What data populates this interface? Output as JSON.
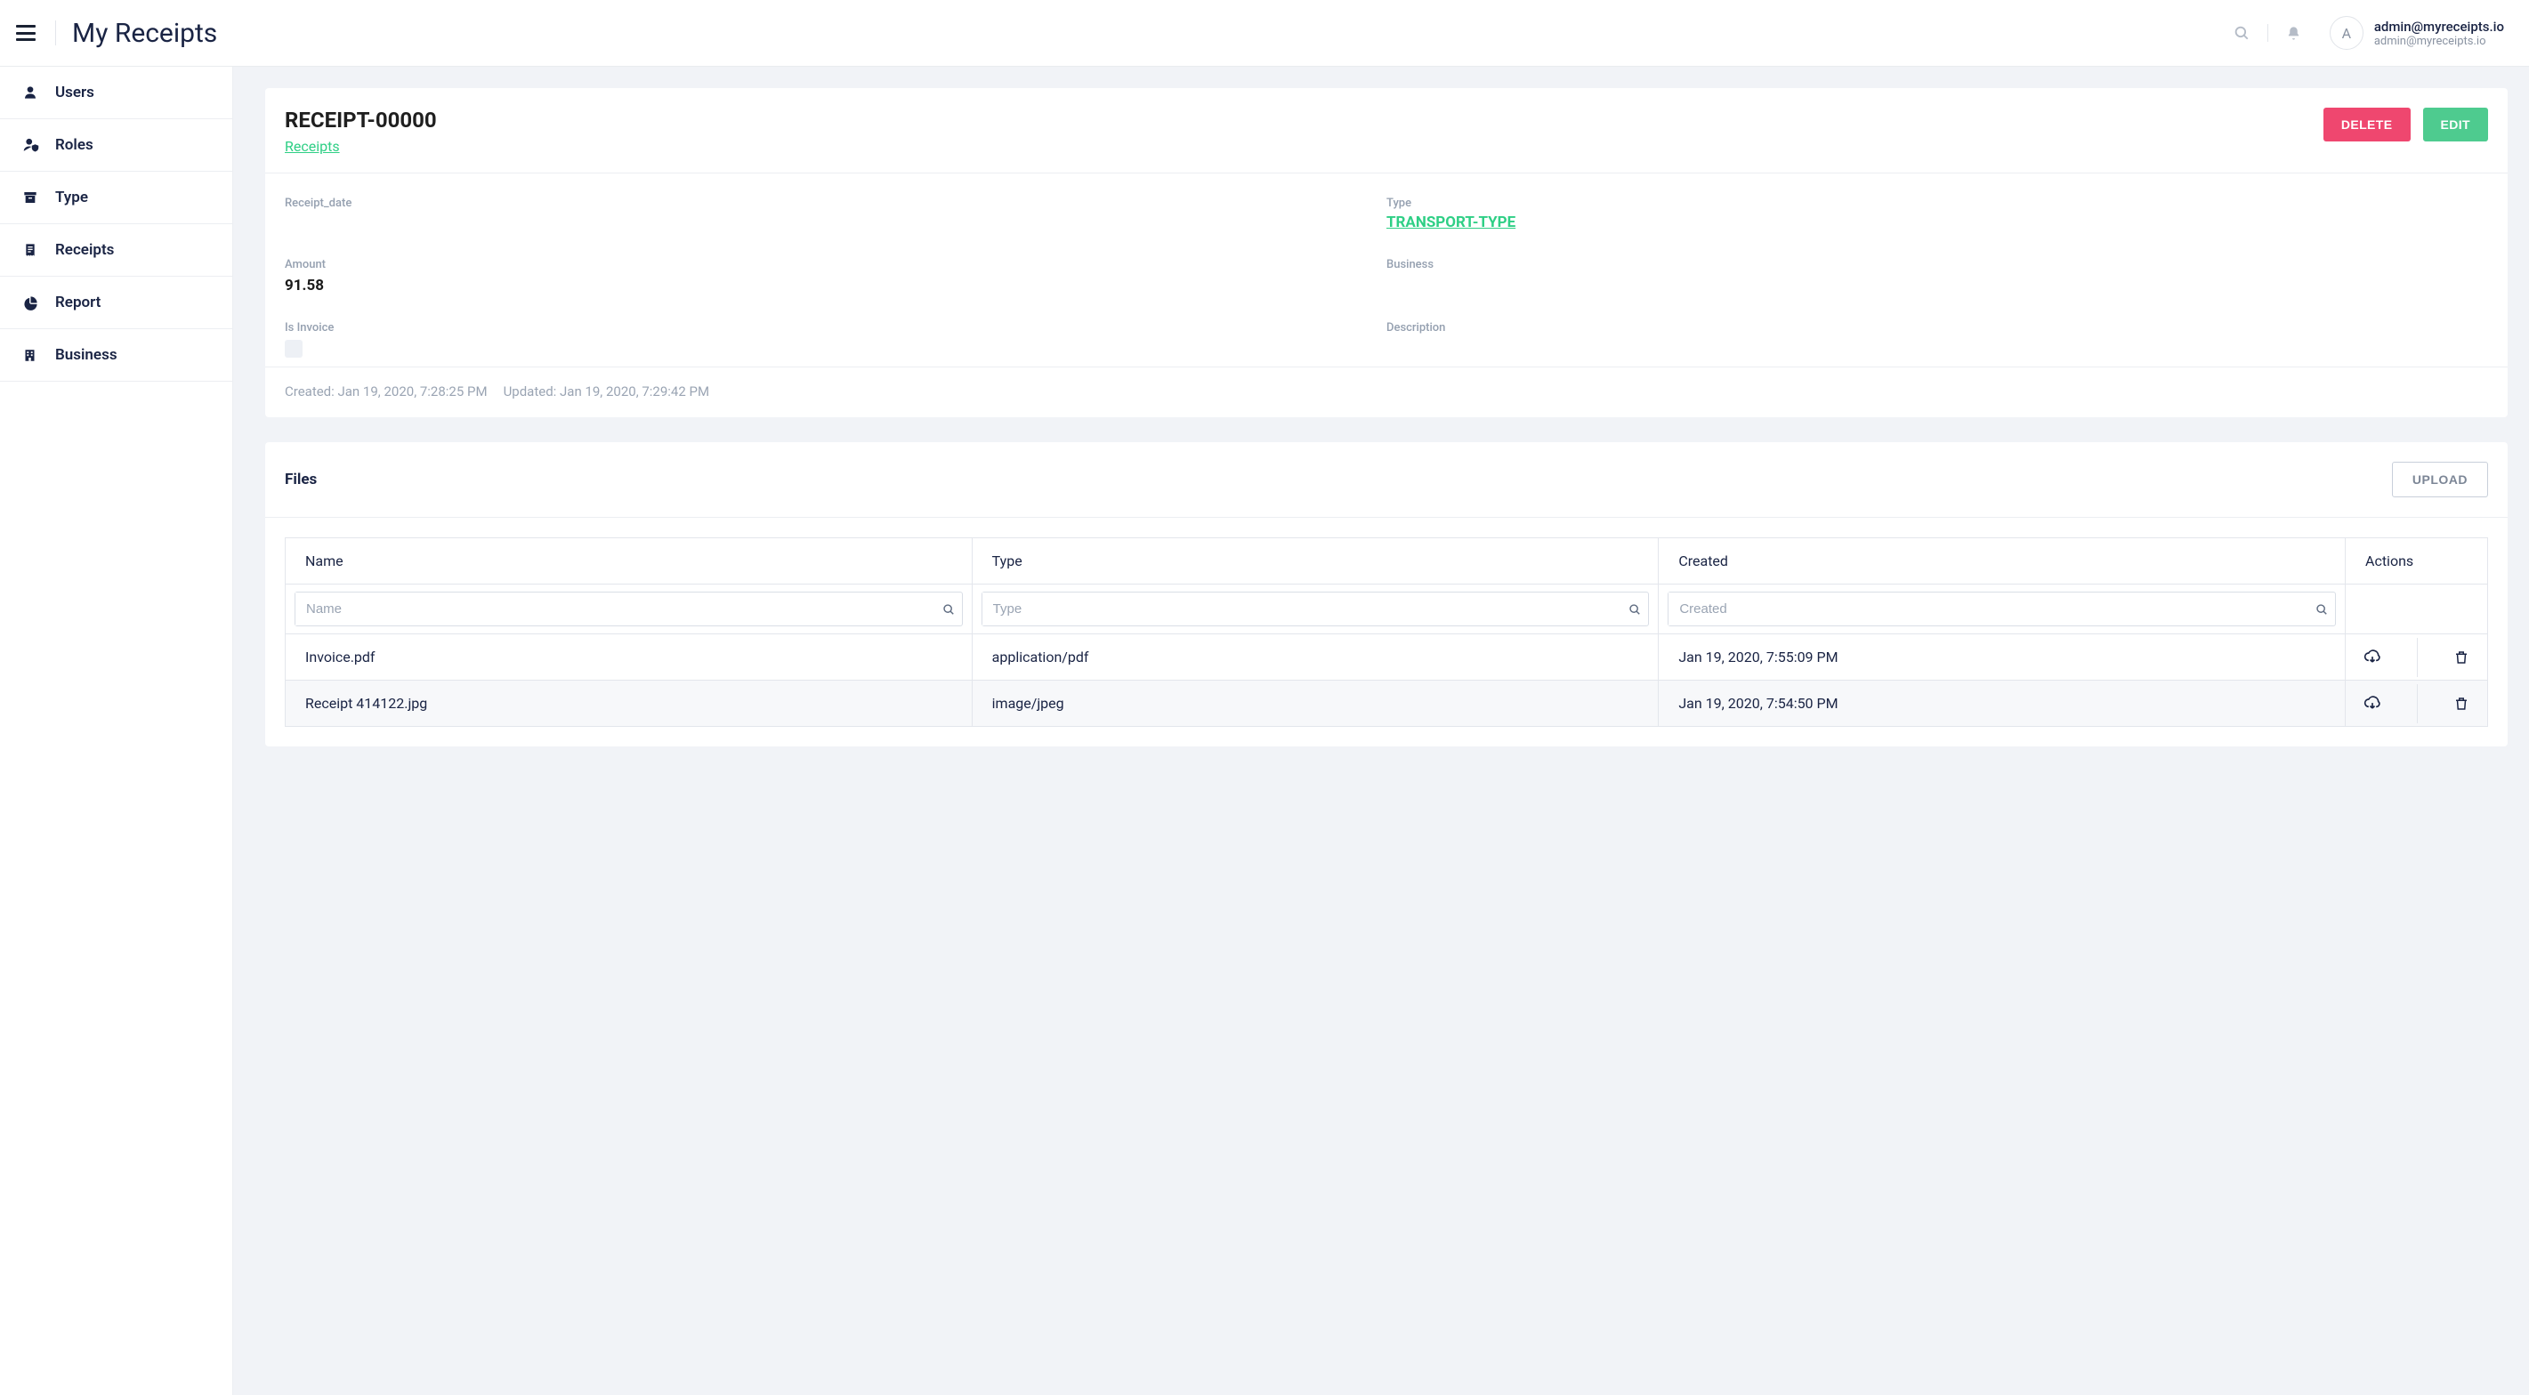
{
  "topbar": {
    "app_title": "My Receipts",
    "avatar_letter": "A",
    "user_primary": "admin@myreceipts.io",
    "user_secondary": "admin@myreceipts.io"
  },
  "sidebar": {
    "items": [
      {
        "label": "Users",
        "icon": "user-icon"
      },
      {
        "label": "Roles",
        "icon": "user-shield-icon"
      },
      {
        "label": "Type",
        "icon": "archive-icon"
      },
      {
        "label": "Receipts",
        "icon": "receipt-icon"
      },
      {
        "label": "Report",
        "icon": "pie-chart-icon"
      },
      {
        "label": "Business",
        "icon": "building-icon"
      }
    ]
  },
  "detail": {
    "title": "RECEIPT-00000",
    "crumb": "Receipts",
    "delete_label": "DELETE",
    "edit_label": "EDIT",
    "fields": {
      "receipt_date_label": "Receipt_date",
      "receipt_date_value": "",
      "type_label": "Type",
      "type_value": "TRANSPORT-TYPE",
      "amount_label": "Amount",
      "amount_value": "91.58",
      "business_label": "Business",
      "business_value": "",
      "is_invoice_label": "Is Invoice",
      "description_label": "Description",
      "description_value": ""
    },
    "created": "Created: Jan 19, 2020, 7:28:25 PM",
    "updated": "Updated: Jan 19, 2020, 7:29:42 PM"
  },
  "files": {
    "title": "Files",
    "upload_label": "UPLOAD",
    "columns": {
      "name": "Name",
      "type": "Type",
      "created": "Created",
      "actions": "Actions"
    },
    "filters": {
      "name_ph": "Name",
      "type_ph": "Type",
      "created_ph": "Created"
    },
    "rows": [
      {
        "name": "Invoice.pdf",
        "type": "application/pdf",
        "created": "Jan 19, 2020, 7:55:09 PM"
      },
      {
        "name": "Receipt 414122.jpg",
        "type": "image/jpeg",
        "created": "Jan 19, 2020, 7:54:50 PM"
      }
    ]
  }
}
